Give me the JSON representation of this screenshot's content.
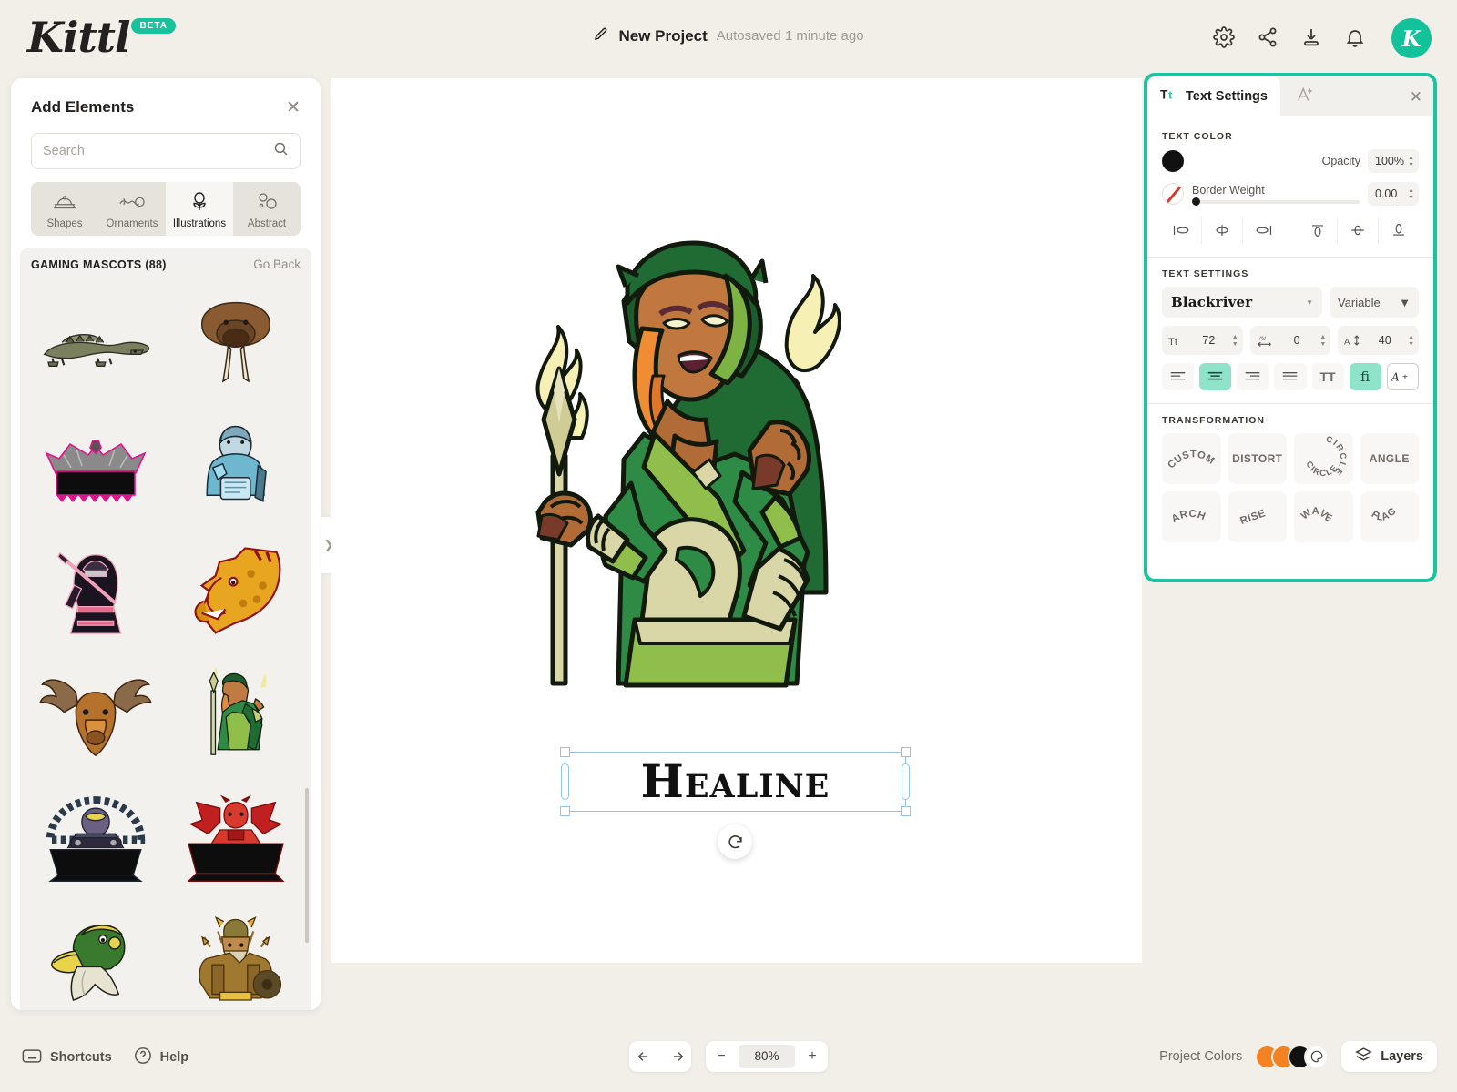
{
  "header": {
    "logo_text": "Kittl",
    "beta_label": "BETA",
    "project_name": "New Project",
    "autosave_status": "Autosaved 1 minute ago",
    "icons": [
      "settings-gear-icon",
      "share-icon",
      "download-icon",
      "notification-bell-icon"
    ],
    "avatar_initial": "K"
  },
  "rail": {
    "items": [
      {
        "name": "design-edit",
        "icon": "pencil-square-icon"
      },
      {
        "name": "templates",
        "icon": "layout-template-icon"
      },
      {
        "name": "text",
        "icon": "text-tt-icon"
      },
      {
        "name": "elements",
        "icon": "elements-circle-icon",
        "active": true
      },
      {
        "name": "uploads",
        "icon": "cloud-upload-icon"
      },
      {
        "name": "photos",
        "icon": "camera-icon"
      },
      {
        "name": "patterns",
        "icon": "grid-dots-icon"
      }
    ]
  },
  "left_panel": {
    "title": "Add Elements",
    "close_icon": "close-icon",
    "search": {
      "value": "",
      "placeholder": "Search",
      "icon": "search-icon"
    },
    "tabs": [
      {
        "label": "Shapes",
        "icon": "shapes-icon",
        "active": false
      },
      {
        "label": "Ornaments",
        "icon": "ornaments-swirl-icon",
        "active": false
      },
      {
        "label": "Illustrations",
        "icon": "illustrations-flower-icon",
        "active": true
      },
      {
        "label": "Abstract",
        "icon": "abstract-blobs-icon",
        "active": false
      }
    ],
    "category": {
      "name": "GAMING MASCOTS (88)",
      "back_label": "Go Back"
    },
    "thumbnails": [
      "crocodile-mascot",
      "walrus-tusks-mascot",
      "winged-eagle-banner-mascot",
      "ice-wizard-mascot",
      "hooded-assassin-mascot",
      "giraffe-head-mascot",
      "moose-head-mascot",
      "green-sorceress-mascot",
      "gamer-alien-banner-mascot",
      "red-demon-banner-mascot",
      "duck-head-mascot",
      "viking-warrior-mascot"
    ],
    "collapse_icon": "chevron-right-icon"
  },
  "canvas": {
    "artwork": "green-sorceress-fire-mage-mascot",
    "headline_text": "Healine",
    "rotate_icon": "rotate-handle-icon"
  },
  "right_panel": {
    "tabs": [
      {
        "label": "Text Settings",
        "icon": "text-tt-icon",
        "active": true
      },
      {
        "label": "",
        "icon": "ai-text-effects-icon",
        "active": false
      }
    ],
    "close_icon": "close-icon",
    "accent_color": "#1bc4a1",
    "text_color": {
      "section_label": "TEXT COLOR",
      "swatch_color": "#111111",
      "opacity_label": "Opacity",
      "opacity_value": "100%"
    },
    "border": {
      "label": "Border Weight",
      "value": "0.00",
      "swatch": "none-diagonal-red-icon"
    },
    "align_buttons": [
      {
        "name": "align-left",
        "icon": "align-left-icon"
      },
      {
        "name": "align-center-horizontal",
        "icon": "align-center-h-icon"
      },
      {
        "name": "align-right",
        "icon": "align-right-icon"
      },
      {
        "name": "align-top",
        "icon": "align-top-icon"
      },
      {
        "name": "align-middle-vertical",
        "icon": "align-middle-v-icon"
      },
      {
        "name": "align-bottom",
        "icon": "align-bottom-icon"
      }
    ],
    "text_settings": {
      "section_label": "TEXT SETTINGS",
      "font_family": "Blackriver",
      "font_variant": "Variable",
      "font_size": "72",
      "letter_spacing": "0",
      "line_height": "40",
      "style_buttons": [
        {
          "name": "text-align-left",
          "label": "",
          "icon": "text-align-left-icon",
          "active": false
        },
        {
          "name": "text-align-center",
          "label": "",
          "icon": "text-align-center-icon",
          "active": true
        },
        {
          "name": "text-align-right",
          "label": "",
          "icon": "text-align-right-icon",
          "active": false
        },
        {
          "name": "text-align-justify",
          "label": "",
          "icon": "text-align-justify-icon",
          "active": false
        },
        {
          "name": "uppercase-toggle",
          "label": "TT",
          "icon": "uppercase-icon",
          "active": false
        },
        {
          "name": "ligature-toggle",
          "label": "fi",
          "icon": "ligature-icon",
          "active": true
        },
        {
          "name": "add-font-style",
          "label": "A+",
          "icon": "add-font-icon",
          "active": false
        }
      ]
    },
    "transformation": {
      "section_label": "TRANSFORMATION",
      "options": [
        "CUSTOM",
        "DISTORT",
        "CIRCLE",
        "ANGLE",
        "ARCH",
        "RISE",
        "WAVE",
        "FLAG"
      ]
    }
  },
  "footer": {
    "shortcuts_label": "Shortcuts",
    "shortcuts_icon": "keyboard-icon",
    "help_label": "Help",
    "help_icon": "question-circle-icon",
    "undo_icon": "undo-arrow-icon",
    "redo_icon": "redo-arrow-icon",
    "zoom_out_label": "−",
    "zoom_value": "80%",
    "zoom_in_label": "+",
    "project_colors_label": "Project Colors",
    "project_colors": [
      "#f58220",
      "#f58220",
      "#111111"
    ],
    "palette_icon": "palette-icon",
    "layers_label": "Layers",
    "layers_icon": "layers-icon"
  }
}
